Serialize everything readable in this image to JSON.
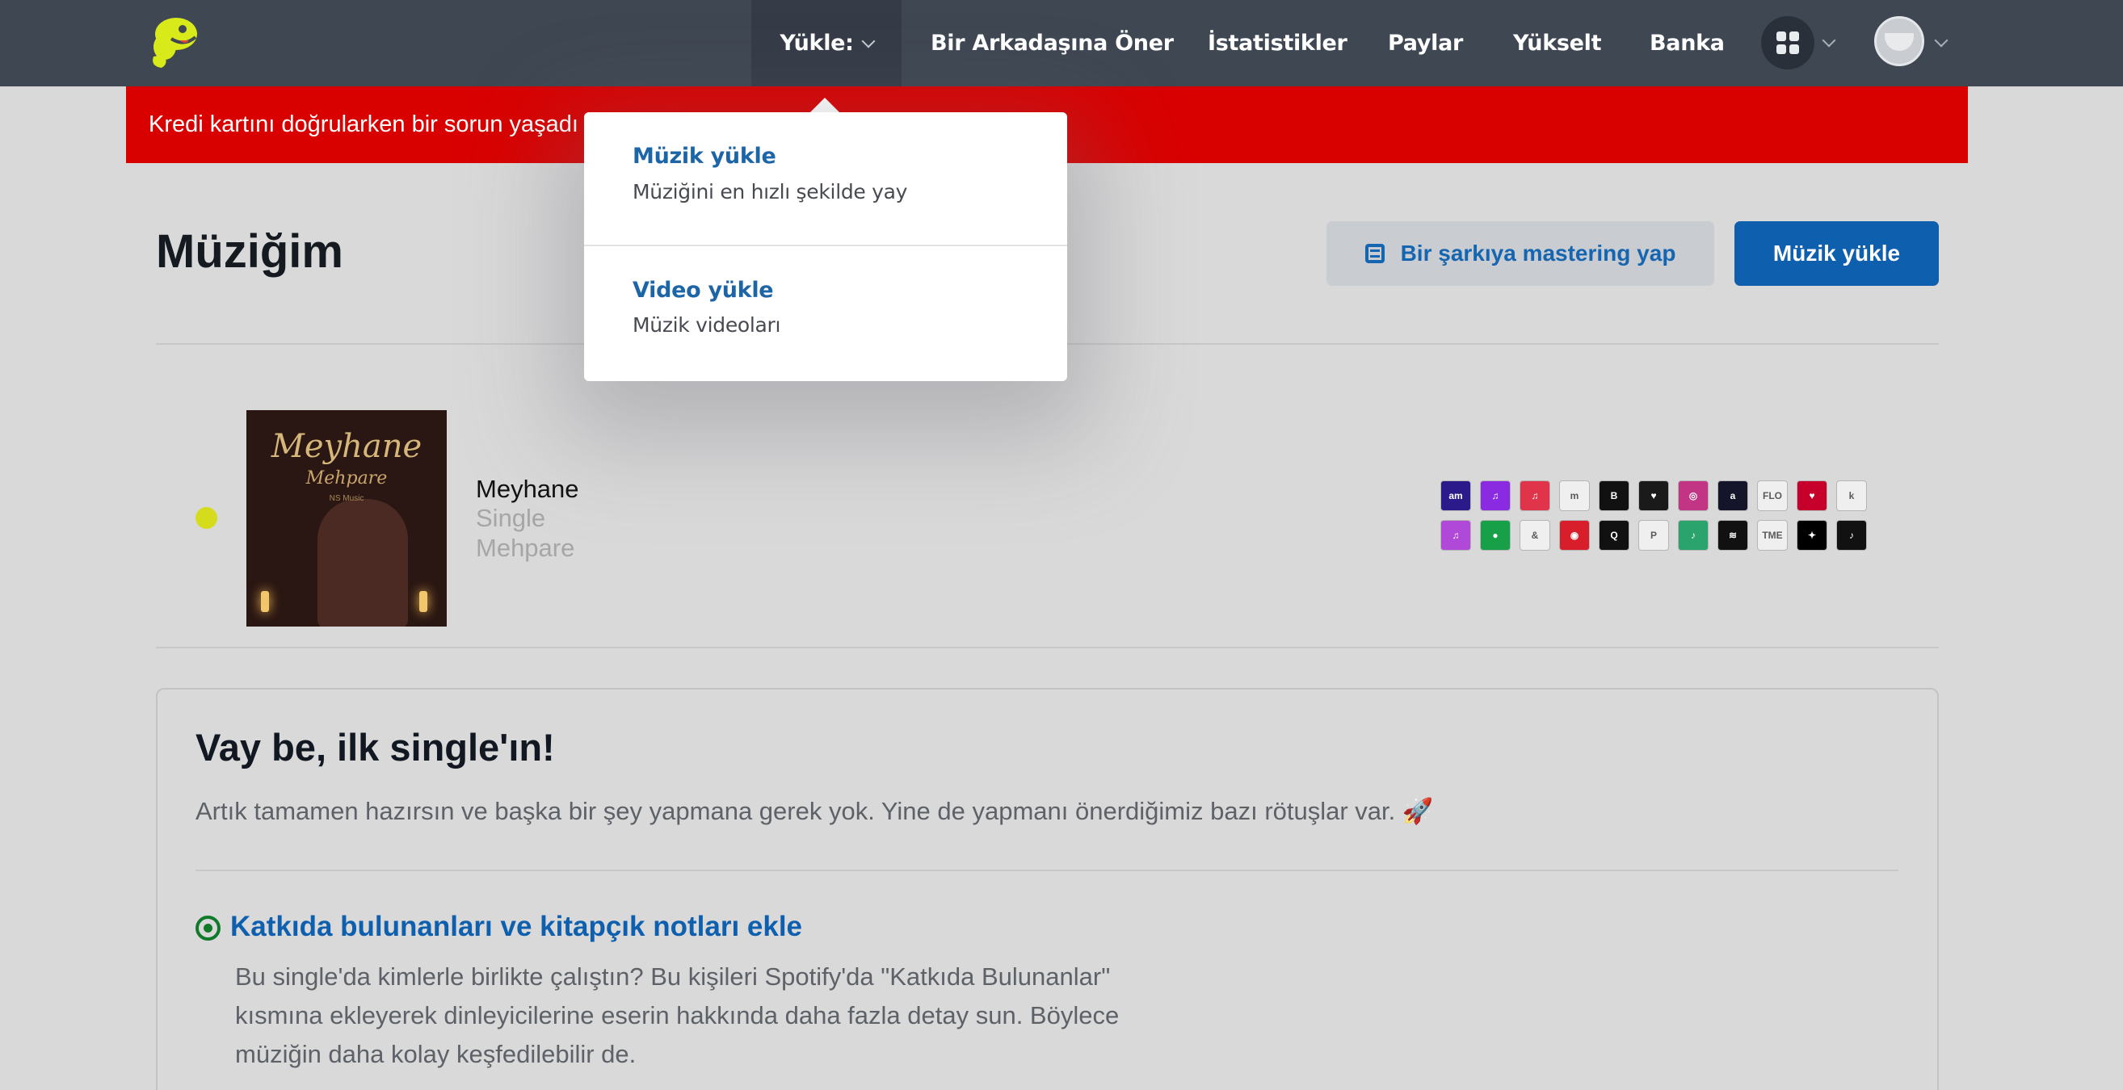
{
  "nav": {
    "logo_icon": "distrokid-mascot-icon",
    "upload_label": "Yükle:",
    "refer_label": "Bir Arkadaşına Öner",
    "stats_label": "İstatistikler",
    "shares_label": "Paylar",
    "upgrade_label": "Yükselt",
    "bank_label": "Banka",
    "apps_icon": "apps-grid-icon",
    "avatar_icon": "user-avatar-icon"
  },
  "alert": {
    "text": "Kredi kartını doğrularken bir sorun yaşadı",
    "color": "#d90000"
  },
  "dropdown": {
    "items": [
      {
        "title": "Müzik yükle",
        "description": "Müziğini en hızlı şekilde yay"
      },
      {
        "title": "Video yükle",
        "description": "Müzik videoları"
      }
    ]
  },
  "page": {
    "title": "Müziğim",
    "mastering_button": "Bir şarkıya mastering yap",
    "upload_button": "Müzik yükle",
    "accent_color": "#0e5fae"
  },
  "release": {
    "title": "Meyhane",
    "type": "Single",
    "artist": "Mehpare",
    "cover_title": "Meyhane",
    "cover_artist": "Mehpare",
    "cover_label": "NS Music",
    "status_color": "#d4dc1c",
    "stores": [
      {
        "name": "amazon-music",
        "color": "#2a1a8a",
        "glyph": "am"
      },
      {
        "name": "anghami",
        "color": "#8a2be2",
        "glyph": "♫"
      },
      {
        "name": "apple-music",
        "color": "#e0344a",
        "glyph": "♫"
      },
      {
        "name": "mm",
        "color": "#efefef",
        "glyph": "m"
      },
      {
        "name": "boomplay",
        "color": "#111111",
        "glyph": "B"
      },
      {
        "name": "deezer",
        "color": "#1a1a1a",
        "glyph": "♥"
      },
      {
        "name": "instagram",
        "color": "#c13584",
        "glyph": "◎"
      },
      {
        "name": "adaptr",
        "color": "#14142a",
        "glyph": "a"
      },
      {
        "name": "flo",
        "color": "#efefef",
        "glyph": "FLO"
      },
      {
        "name": "iheartradio",
        "color": "#c6002b",
        "glyph": "♥"
      },
      {
        "name": "kkbox",
        "color": "#efefef",
        "glyph": "k"
      },
      {
        "name": "itunes",
        "color": "#b048d8",
        "glyph": "♫"
      },
      {
        "name": "audiomack",
        "color": "#18a048",
        "glyph": "●"
      },
      {
        "name": "qobuz-orange",
        "color": "#efefef",
        "glyph": "&"
      },
      {
        "name": "netease",
        "color": "#d81e2a",
        "glyph": "◉"
      },
      {
        "name": "qobuz",
        "color": "#111111",
        "glyph": "Q"
      },
      {
        "name": "pandora",
        "color": "#efefef",
        "glyph": "P"
      },
      {
        "name": "jiosaavn",
        "color": "#2ba36c",
        "glyph": "♪"
      },
      {
        "name": "spotify",
        "color": "#111111",
        "glyph": "≋"
      },
      {
        "name": "tme",
        "color": "#efefef",
        "glyph": "TME"
      },
      {
        "name": "tidal",
        "color": "#000000",
        "glyph": "✦"
      },
      {
        "name": "tiktok",
        "color": "#111111",
        "glyph": "♪"
      }
    ]
  },
  "card": {
    "title": "Vay be, ilk single'ın!",
    "description": "Artık tamamen hazırsın ve başka bir şey yapmana gerek yok. Yine de yapmanı önerdiğimiz bazı rötuşlar var. 🚀",
    "task_title": "Katkıda bulunanları ve kitapçık notları ekle",
    "task_body": "Bu single'da kimlerle birlikte çalıştın? Bu kişileri Spotify'da \"Katkıda Bulunanlar\" kısmına ekleyerek dinleyicilerine eserin hakkında daha fazla detay sun. Böylece müziğin daha kolay keşfedilebilir de."
  }
}
